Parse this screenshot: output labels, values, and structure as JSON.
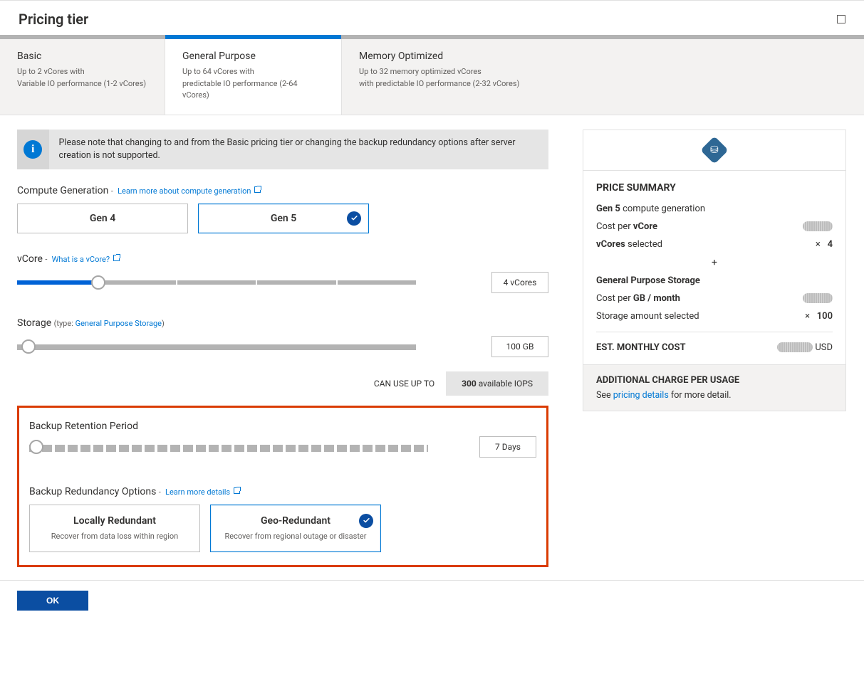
{
  "header": {
    "title": "Pricing tier"
  },
  "tiers": [
    {
      "name": "Basic",
      "line1": "Up to 2 vCores with",
      "line2": "Variable IO performance (1-2 vCores)"
    },
    {
      "name": "General Purpose",
      "line1": "Up to 64 vCores with",
      "line2": "predictable IO performance (2-64 vCores)"
    },
    {
      "name": "Memory Optimized",
      "line1": "Up to 32 memory optimized vCores",
      "line2": "with predictable IO performance (2-32 vCores)"
    }
  ],
  "infobox": "Please note that changing to and from the Basic pricing tier or changing the backup redundancy options after server creation is not supported.",
  "compute_gen": {
    "label": "Compute Generation",
    "link": "Learn more about compute generation",
    "options": [
      "Gen 4",
      "Gen 5"
    ],
    "selected": "Gen 5"
  },
  "vcore": {
    "label": "vCore",
    "link": "What is a vCore?",
    "value": "4 vCores"
  },
  "storage": {
    "label": "Storage",
    "type_prefix": "(type:",
    "type_link": "General Purpose Storage",
    "type_suffix": ")",
    "value": "100 GB",
    "iops_left": "CAN USE UP TO",
    "iops_right_num": "300",
    "iops_right_text": " available IOPS"
  },
  "backup_retention": {
    "label": "Backup Retention Period",
    "value": "7 Days"
  },
  "redundancy": {
    "label": "Backup Redundancy Options",
    "link": "Learn more details",
    "options": [
      {
        "title": "Locally Redundant",
        "desc": "Recover from data loss within region"
      },
      {
        "title": "Geo-Redundant",
        "desc": "Recover from regional outage or disaster"
      }
    ],
    "selected": 1
  },
  "summary": {
    "title": "PRICE SUMMARY",
    "gen_bold": "Gen 5",
    "gen_rest": " compute generation",
    "cost_vcore_lbl_pre": "Cost per ",
    "cost_vcore_lbl_bold": "vCore",
    "vcores_sel_bold": "vCores",
    "vcores_sel_rest": " selected",
    "vcores_val": "4",
    "times": "×",
    "plus": "+",
    "storage_h": "General Purpose Storage",
    "cost_gb_pre": "Cost per ",
    "cost_gb_bold": "GB / month",
    "storage_amt_lbl": "Storage amount selected",
    "storage_amt_val": "100",
    "est": "EST. MONTHLY COST",
    "est_cur": "USD",
    "footer_title": "ADDITIONAL CHARGE PER USAGE",
    "footer_pre": "See ",
    "footer_link": "pricing details",
    "footer_post": " for more detail."
  },
  "ok": "OK"
}
